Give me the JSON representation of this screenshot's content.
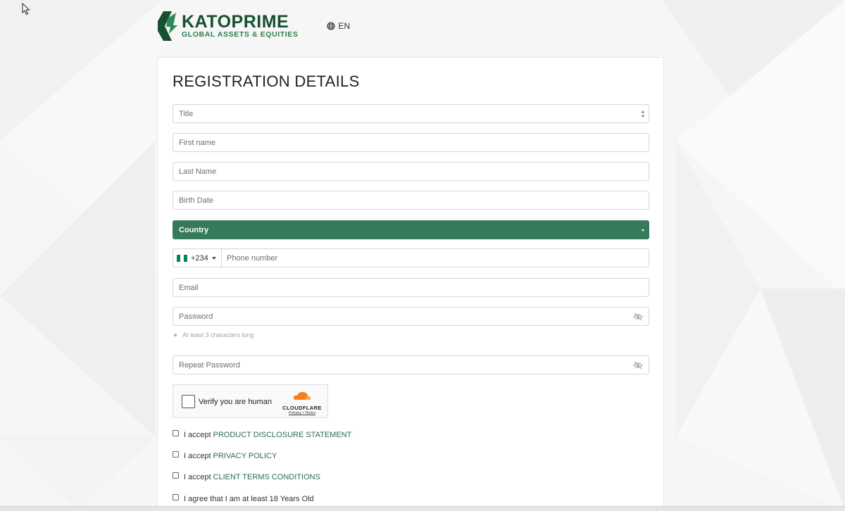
{
  "brand": {
    "name": "KATOPRIME",
    "tagline": "GLOBAL ASSETS & EQUITIES",
    "green_dark": "#17502e",
    "green_accent": "#367a5a"
  },
  "language": {
    "label": "EN",
    "icon": "globe-icon"
  },
  "form": {
    "title": "REGISTRATION DETAILS",
    "title_select": {
      "value": "Title"
    },
    "first_name": {
      "placeholder": "First name"
    },
    "last_name": {
      "placeholder": "Last Name"
    },
    "birth_date": {
      "placeholder": "Birth Date"
    },
    "country": {
      "value": "Country"
    },
    "phone": {
      "dial_code": "+234",
      "flag": "nigeria-flag-icon",
      "placeholder": "Phone number"
    },
    "email": {
      "placeholder": "Email"
    },
    "password": {
      "placeholder": "Password",
      "hint": "At least 3 characters long"
    },
    "repeat_password": {
      "placeholder": "Repeat Password"
    }
  },
  "captcha": {
    "label": "Verify you are human",
    "provider": "CLOUDFLARE",
    "privacy": "Privacy",
    "separator": "•",
    "terms": "Terms"
  },
  "agreements": [
    {
      "prefix": "I accept",
      "link": "PRODUCT DISCLOSURE STATEMENT"
    },
    {
      "prefix": "I accept",
      "link": "PRIVACY POLICY"
    },
    {
      "prefix": "I accept",
      "link": "CLIENT TERMS CONDITIONS"
    },
    {
      "prefix": "I agree that I am at least 18 Years Old",
      "link": ""
    }
  ]
}
